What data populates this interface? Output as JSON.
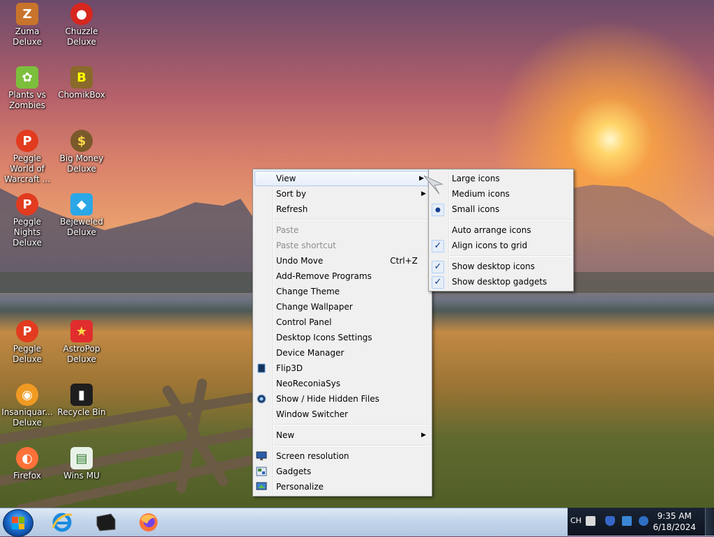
{
  "desktop_icons": [
    {
      "label": "Zuma Deluxe",
      "icon": "zuma-icon"
    },
    {
      "label": "Chuzzle Deluxe",
      "icon": "chuzzle-icon"
    },
    {
      "label": "Plants vs Zombies",
      "icon": "plants-vs-zombies-icon"
    },
    {
      "label": "ChomikBox",
      "icon": "chomikbox-icon"
    },
    {
      "label": "Peggle World of Warcraft ...",
      "icon": "peggle-icon"
    },
    {
      "label": "Big Money Deluxe",
      "icon": "money-bag-icon"
    },
    {
      "label": "Peggle Nights Deluxe",
      "icon": "peggle-icon"
    },
    {
      "label": "Bejeweled Deluxe",
      "icon": "gem-icon"
    },
    {
      "label": "Peggle Deluxe",
      "icon": "peggle-icon"
    },
    {
      "label": "AstroPop Deluxe",
      "icon": "astropop-icon"
    },
    {
      "label": "Insaniquar... Deluxe",
      "icon": "fish-icon"
    },
    {
      "label": "Recycle Bin",
      "icon": "recycle-bin-icon"
    },
    {
      "label": "Firefox",
      "icon": "firefox-icon"
    },
    {
      "label": "Wins MU",
      "icon": "document-icon"
    }
  ],
  "context_menu": {
    "view": "View",
    "sort_by": "Sort by",
    "refresh": "Refresh",
    "paste": "Paste",
    "paste_shortcut": "Paste shortcut",
    "undo_move": "Undo Move",
    "undo_shortcut": "Ctrl+Z",
    "add_remove": "Add-Remove Programs",
    "change_theme": "Change Theme",
    "change_wallpaper": "Change Wallpaper",
    "control_panel": "Control Panel",
    "desktop_icons_settings": "Desktop Icons Settings",
    "device_manager": "Device Manager",
    "flip3d": "Flip3D",
    "neoreconiasys": "NeoReconiaSys",
    "show_hide_hidden": "Show / Hide Hidden Files",
    "window_switcher": "Window Switcher",
    "new": "New",
    "screen_resolution": "Screen resolution",
    "gadgets": "Gadgets",
    "personalize": "Personalize"
  },
  "view_submenu": {
    "large_icons": "Large icons",
    "medium_icons": "Medium icons",
    "small_icons": "Small icons",
    "auto_arrange": "Auto arrange icons",
    "align_to_grid": "Align icons to grid",
    "show_desktop_icons": "Show desktop icons",
    "show_desktop_gadgets": "Show desktop gadgets",
    "selected_size": "Small icons",
    "auto_arrange_checked": false,
    "align_checked": true,
    "show_icons_checked": true,
    "show_gadgets_checked": true
  },
  "taskbar": {
    "apps": [
      "internet-explorer-icon",
      "terminal-icon",
      "firefox-icon"
    ]
  },
  "tray": {
    "language": "CH",
    "time": "9:35 AM",
    "date": "6/18/2024"
  }
}
